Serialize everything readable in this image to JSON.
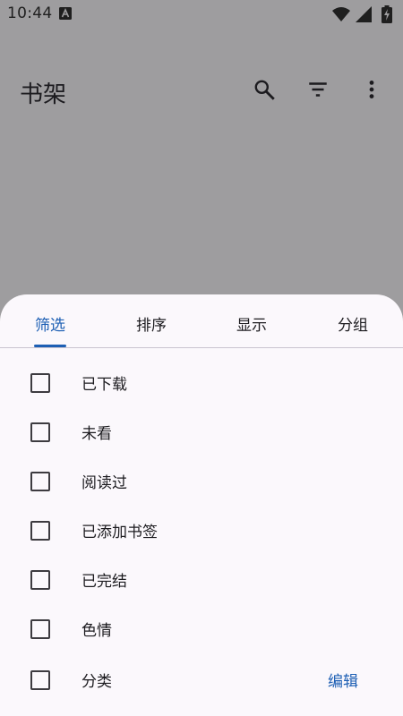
{
  "status_bar": {
    "time": "10:44",
    "icons": [
      "text-a-icon",
      "wifi-icon",
      "signal-icon",
      "battery-charging-icon"
    ]
  },
  "app_bar": {
    "title": "书架",
    "actions": [
      "search-icon",
      "filter-icon",
      "more-vert-icon"
    ]
  },
  "sheet": {
    "tabs": [
      {
        "label": "筛选",
        "active": true
      },
      {
        "label": "排序",
        "active": false
      },
      {
        "label": "显示",
        "active": false
      },
      {
        "label": "分组",
        "active": false
      }
    ],
    "filters": [
      {
        "label": "已下载",
        "checked": false
      },
      {
        "label": "未看",
        "checked": false
      },
      {
        "label": "阅读过",
        "checked": false
      },
      {
        "label": "已添加书签",
        "checked": false
      },
      {
        "label": "已完结",
        "checked": false
      },
      {
        "label": "色情",
        "checked": false
      },
      {
        "label": "分类",
        "checked": false
      }
    ],
    "edit_label": "编辑"
  },
  "colors": {
    "accent": "#1d5fb4",
    "scrim": "#9e9d9f",
    "sheet_bg": "#fbf8fc"
  }
}
